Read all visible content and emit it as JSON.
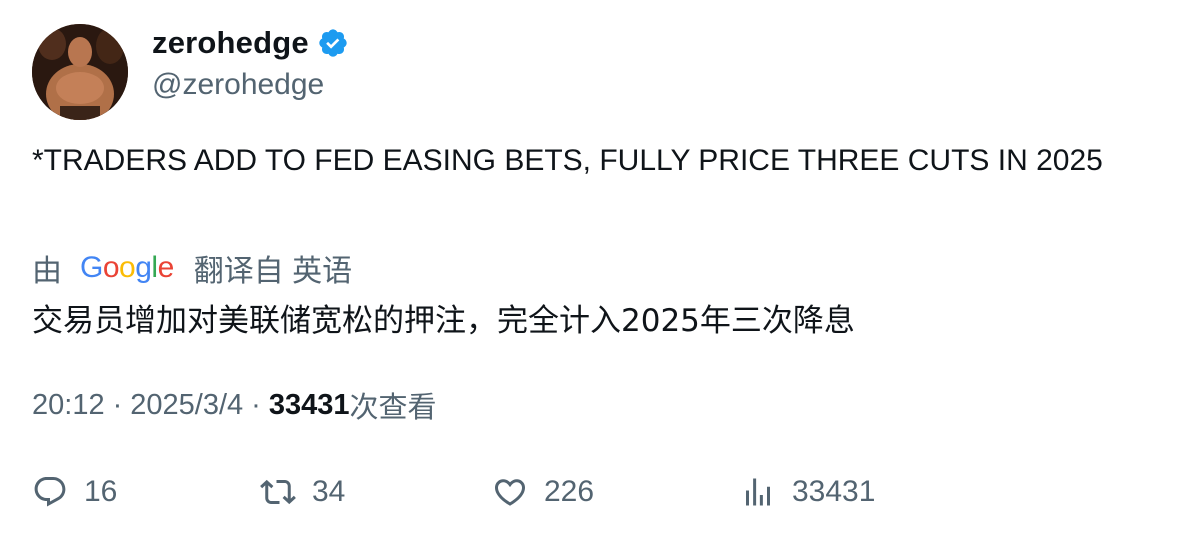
{
  "author": {
    "display_name": "zerohedge",
    "handle": "@zerohedge",
    "verified_icon": "verified-badge-icon",
    "verified_color": "#1d9bf0"
  },
  "tweet": {
    "text": "*TRADERS ADD TO FED EASING BETS, FULLY PRICE THREE CUTS IN 2025"
  },
  "translation": {
    "prefix": "由",
    "provider_logo": "Google",
    "suffix": "翻译自 英语",
    "text": "交易员增加对美联储宽松的押注，完全计入2025年三次降息"
  },
  "meta": {
    "time": "20:12",
    "date": "2025/3/4",
    "separator": "·",
    "views_count": "33431",
    "views_label": "次查看"
  },
  "actions": {
    "replies": "16",
    "retweets": "34",
    "likes": "226",
    "views": "33431"
  },
  "colors": {
    "text": "#0f1419",
    "secondary": "#536471"
  }
}
